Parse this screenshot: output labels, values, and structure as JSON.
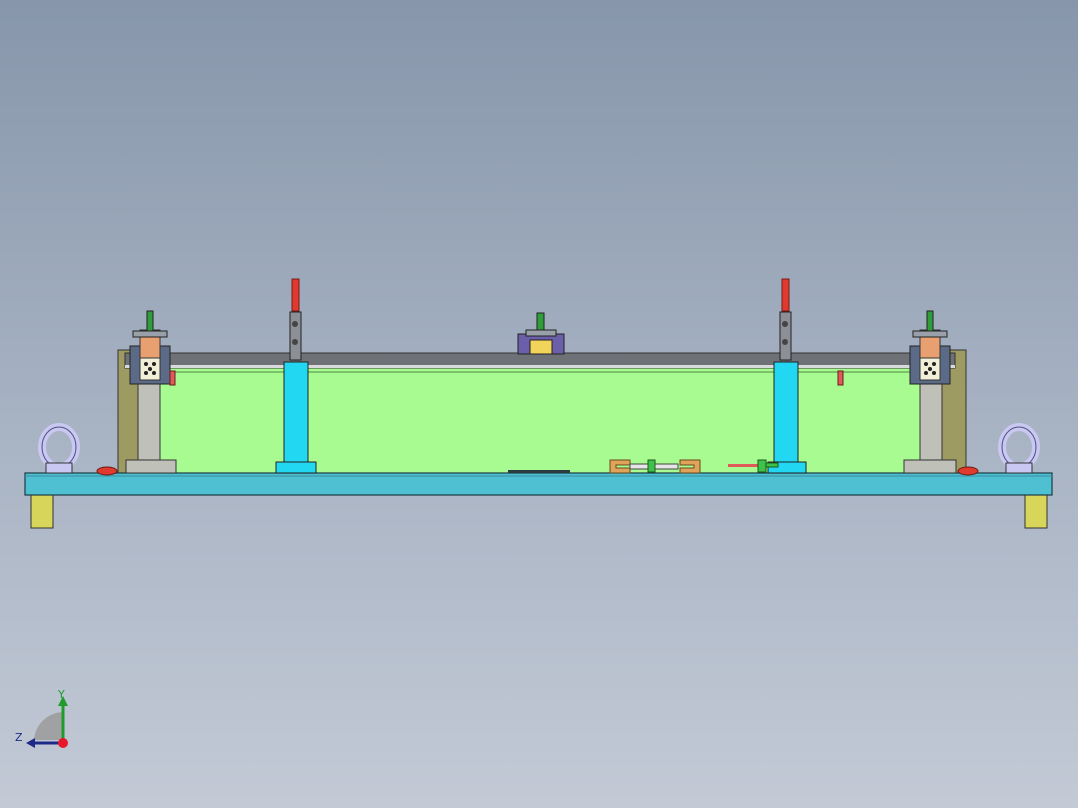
{
  "viewport": {
    "background_top": "#8796ab",
    "background_bottom": "#c3cad6"
  },
  "colors": {
    "base_plate": "#4fbfd2",
    "fixture_body": "#a8fb90",
    "top_cover": "#6e7276",
    "column": "#22d7f2",
    "bracket": "#bfc0b8",
    "side_block": "#9e9b62",
    "foot": "#d7d65a",
    "eyebolt": "#c9c8f2",
    "handle_red": "#e03a2f",
    "clamp_copper": "#e8a070"
  },
  "triad": {
    "y_label": "Y",
    "z_label": "Z",
    "y_color": "#1f9a2b",
    "z_color": "#1e2b86",
    "x_color": "#e8182a"
  }
}
